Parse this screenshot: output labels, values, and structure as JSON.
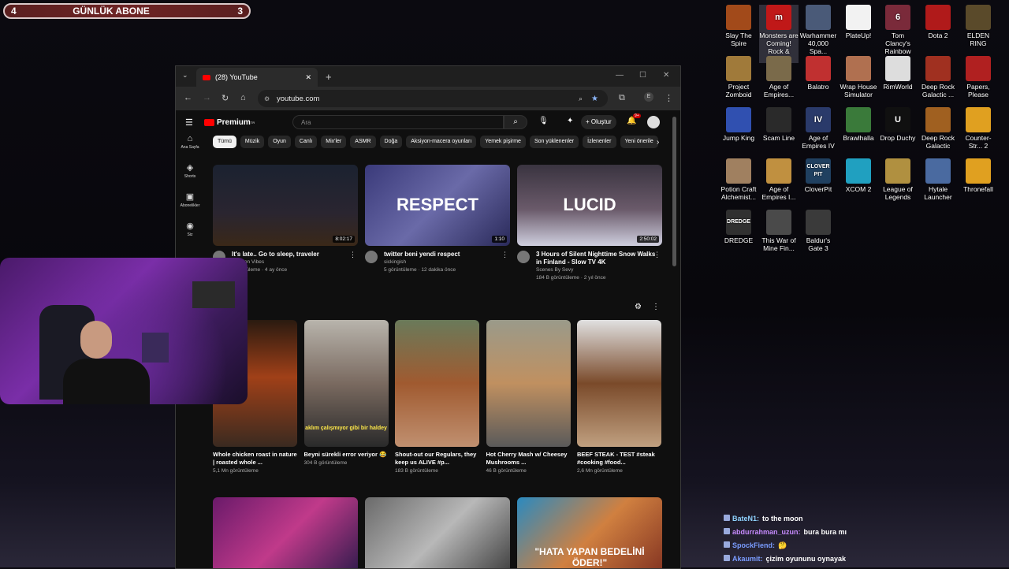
{
  "subbar": {
    "left": "4",
    "title": "GÜNLÜK ABONE",
    "right": "3"
  },
  "desktop": {
    "icons": [
      {
        "label": "Slay The Spire",
        "icon": "slay-the-spire-icon",
        "color": "#a24a1a",
        "glyph": ""
      },
      {
        "label": "Monsters are Coming! Rock & Road",
        "icon": "monsters-icon",
        "color": "#c01818",
        "glyph": "m"
      },
      {
        "label": "Warhammer 40,000 Spa...",
        "icon": "warhammer-icon",
        "color": "#4a5a78",
        "glyph": ""
      },
      {
        "label": "PlateUp!",
        "icon": "file-icon",
        "color": "#f2f2f2",
        "glyph": ""
      },
      {
        "label": "Tom Clancy's Rainbow Si...",
        "icon": "rainbow-six-icon",
        "color": "#7a2a3a",
        "glyph": "6"
      },
      {
        "label": "Dota 2",
        "icon": "dota2-icon",
        "color": "#b01a1a",
        "glyph": ""
      },
      {
        "label": "ELDEN RING",
        "icon": "elden-ring-icon",
        "color": "#5a4a2a",
        "glyph": ""
      },
      {
        "label": "Project Zomboid",
        "icon": "project-zomboid-icon",
        "color": "#a07a3a",
        "glyph": ""
      },
      {
        "label": "Age of Empires...",
        "icon": "age-of-empires-icon",
        "color": "#7a6a4a",
        "glyph": ""
      },
      {
        "label": "Balatro",
        "icon": "balatro-icon",
        "color": "#c03030",
        "glyph": ""
      },
      {
        "label": "Wrap House Simulator",
        "icon": "wrap-house-icon",
        "color": "#b07050",
        "glyph": ""
      },
      {
        "label": "RimWorld",
        "icon": "rimworld-icon",
        "color": "#dddddd",
        "glyph": ""
      },
      {
        "label": "Deep Rock Galactic ...",
        "icon": "deep-rock-icon",
        "color": "#a03020",
        "glyph": ""
      },
      {
        "label": "Papers, Please",
        "icon": "papers-please-icon",
        "color": "#b02020",
        "glyph": ""
      },
      {
        "label": "Jump King",
        "icon": "jump-king-icon",
        "color": "#3050b0",
        "glyph": ""
      },
      {
        "label": "Scam Line",
        "icon": "scam-line-icon",
        "color": "#2a2a2a",
        "glyph": ""
      },
      {
        "label": "Age of Empires IV",
        "icon": "age-of-empires-iv-icon",
        "color": "#2a3a6a",
        "glyph": "IV"
      },
      {
        "label": "Brawlhalla",
        "icon": "brawlhalla-icon",
        "color": "#3a7a3a",
        "glyph": ""
      },
      {
        "label": "Drop Duchy",
        "icon": "unreal-icon",
        "color": "#101010",
        "glyph": "U"
      },
      {
        "label": "Deep Rock Galactic",
        "icon": "deep-rock-galactic-icon",
        "color": "#a06020",
        "glyph": ""
      },
      {
        "label": "Counter-Str... 2",
        "icon": "counter-strike-icon",
        "color": "#e0a020",
        "glyph": ""
      },
      {
        "label": "Potion Craft Alchemist...",
        "icon": "potion-craft-icon",
        "color": "#a08060",
        "glyph": ""
      },
      {
        "label": "Age of Empires I...",
        "icon": "age-of-empires-ii-icon",
        "color": "#c09040",
        "glyph": ""
      },
      {
        "label": "CloverPit",
        "icon": "cloverpit-icon",
        "color": "#204060",
        "glyph": "CLOVER PIT"
      },
      {
        "label": "XCOM 2",
        "icon": "xcom2-icon",
        "color": "#20a0c0",
        "glyph": ""
      },
      {
        "label": "League of Legends",
        "icon": "league-icon",
        "color": "#b09040",
        "glyph": ""
      },
      {
        "label": "Hytale Launcher",
        "icon": "hytale-icon",
        "color": "#4a6aa0",
        "glyph": ""
      },
      {
        "label": "Thronefall",
        "icon": "thronefall-icon",
        "color": "#e0a020",
        "glyph": ""
      },
      {
        "label": "DREDGE",
        "icon": "dredge-icon",
        "color": "#303030",
        "glyph": "DREDGE"
      },
      {
        "label": "This War of Mine Fin...",
        "icon": "this-war-of-mine-icon",
        "color": "#4a4a4a",
        "glyph": ""
      },
      {
        "label": "Baldur's Gate 3",
        "icon": "baldurs-gate-icon",
        "color": "#3a3a3a",
        "glyph": ""
      }
    ]
  },
  "browser": {
    "tab_title": "(28) YouTube",
    "tab_close": "✕",
    "new_tab": "+",
    "url": "youtube.com",
    "window_controls": [
      "—",
      "☐",
      "✕"
    ]
  },
  "youtube": {
    "logo_text": "Premium",
    "logo_badge": "TR",
    "search_placeholder": "Ara",
    "create_label": "Oluştur",
    "notif_count": "9+",
    "guide": [
      {
        "icon": "home-icon",
        "glyph": "⌂",
        "label": "Ana Sayfa"
      },
      {
        "icon": "shorts-icon",
        "glyph": "◈",
        "label": "Shorts"
      },
      {
        "icon": "subscriptions-icon",
        "glyph": "▣",
        "label": "Abonelikler"
      },
      {
        "icon": "you-icon",
        "glyph": "◉",
        "label": "Siz"
      }
    ],
    "chips": [
      "Tümü",
      "Müzik",
      "Oyun",
      "Canlı",
      "Mix'ler",
      "ASMR",
      "Doğa",
      "Aksiyon-macera oyunları",
      "Yemek pişirme",
      "Son yüklenenler",
      "İzlenenler",
      "Yeni önerile"
    ],
    "videos": [
      {
        "title": "It's late.. Go to sleep, traveler",
        "channel": "Cartoon Vibes",
        "views": "görüntüleme · 4 ay önce",
        "duration": "8:02:17",
        "bg": "linear-gradient(180deg,#1b2230,#2a2530 60%,#3a2818)"
      },
      {
        "title": "twitter beni yendi respect",
        "channel": "sickingish",
        "views": "5 görüntüleme · 12 dakika önce",
        "duration": "1:10",
        "bg": "linear-gradient(135deg,#3a3a7a,#6a6aa8 50%,#2a2a5a)",
        "overlay": "RESPECT"
      },
      {
        "title": "3 Hours of Silent Nighttime Snow Walks in Finland - Slow TV 4K",
        "channel": "Scenes By Sevy",
        "views": "184 B görüntüleme · 2 yıl önce",
        "duration": "2:50:02",
        "bg": "linear-gradient(180deg,#3a3440,#6a5a6a 55%,#cfcfdf)",
        "overlay": "LUCID"
      },
      {
        "title": "",
        "channel": "",
        "views": "",
        "duration": "",
        "bg": "linear-gradient(135deg,#6a1a6a,#c03a8a 50%,#2a1a4a)"
      },
      {
        "title": "",
        "channel": "",
        "views": "",
        "duration": "",
        "bg": "linear-gradient(135deg,#6a6a6a,#b8b8b8 50%,#3a3a3a)"
      },
      {
        "title": "",
        "channel": "",
        "views": "",
        "duration": "",
        "bg": "linear-gradient(135deg,#2a8ac0,#d08040 50%,#803020)",
        "overlay": "\"HATA YAPAN BEDELİNİ ÖDER!\""
      }
    ],
    "shorts": [
      {
        "title": "Whole chicken roast in nature | roasted whole ...",
        "views": "5,1 Mn görüntüleme",
        "bg": "linear-gradient(180deg,#2a1a10,#a04018 45%,#3a2a20)"
      },
      {
        "title": "Beyni sürekli error veriyor 😂",
        "views": "304 B görüntüleme",
        "bg": "linear-gradient(180deg,#b8b4ac,#7a6a60 50%,#2a2a2a)",
        "caption": "aklım çalışmıyor gibi bir haldey"
      },
      {
        "title": "Shout-out our Regulars, they keep us ALIVE #p...",
        "views": "183 B görüntüleme",
        "bg": "linear-gradient(180deg,#6a7a5a,#a05a30 50%,#c09070)"
      },
      {
        "title": "Hot Cherry Mash w/ Cheesey Mushrooms ...",
        "views": "46 B görüntüleme",
        "bg": "linear-gradient(180deg,#9a9a8a,#c09060 50%,#5a5a5a)"
      },
      {
        "title": "BEEF STEAK - TEST #steak #cooking #food...",
        "views": "2,6 Mn görüntüleme",
        "bg": "linear-gradient(180deg,#e0e0e0,#7a4a2a 50%,#c0a080)"
      }
    ]
  },
  "chat": [
    {
      "user": "BateN1:",
      "user_color": "#8fd3ff",
      "msg": "to the moon"
    },
    {
      "user": "abdurrahman_uzun:",
      "user_color": "#c88cff",
      "msg": "bura bura mı"
    },
    {
      "user": "SpockFiend:",
      "user_color": "#7a9cff",
      "msg": "🤔"
    },
    {
      "user": "Akaumit:",
      "user_color": "#7a9cff",
      "msg": "çizim oyununu oynayak"
    }
  ]
}
